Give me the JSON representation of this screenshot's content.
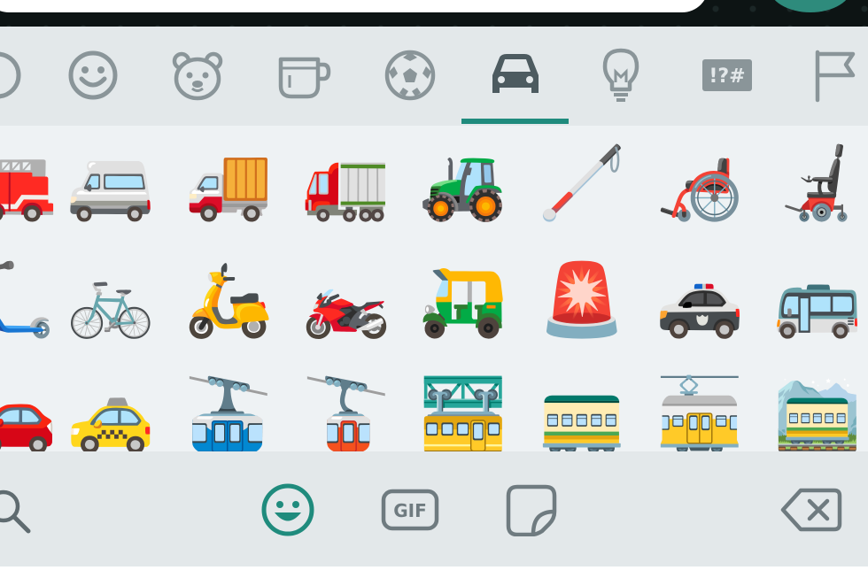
{
  "categories": [
    {
      "name": "recent",
      "icon": "clock-icon",
      "selected": false
    },
    {
      "name": "smileys",
      "icon": "smiley-icon",
      "selected": false
    },
    {
      "name": "animals",
      "icon": "bear-icon",
      "selected": false
    },
    {
      "name": "food",
      "icon": "cup-icon",
      "selected": false
    },
    {
      "name": "activity",
      "icon": "soccer-ball-icon",
      "selected": false
    },
    {
      "name": "travel",
      "icon": "car-icon",
      "selected": true
    },
    {
      "name": "objects",
      "icon": "lightbulb-icon",
      "selected": false
    },
    {
      "name": "symbols",
      "icon": "symbols-icon",
      "label": "!?#",
      "selected": false
    },
    {
      "name": "flags",
      "icon": "flag-icon",
      "selected": false
    }
  ],
  "emoji_rows": [
    [
      "🚒",
      "🚐",
      "🚚",
      "🚛",
      "🚜",
      "🦯",
      "🦽",
      "🦼"
    ],
    [
      "🛴",
      "🚲",
      "🛵",
      "🏍️",
      "🛺",
      "🚨",
      "🚓",
      "🚌"
    ],
    [
      "🚗",
      "🚕",
      "🚠",
      "🚡",
      "🚟",
      "🚃",
      "🚋",
      "🚞"
    ]
  ],
  "bottom_bar": {
    "search_icon": "search-icon",
    "emoji_tab_icon": "emoji-tab-icon",
    "gif_label": "GIF",
    "sticker_icon": "sticker-icon",
    "backspace_icon": "backspace-icon"
  },
  "colors": {
    "accent": "#1f8b7d",
    "icon_gray": "#8a9599",
    "panel_bg": "#e9eef0"
  }
}
